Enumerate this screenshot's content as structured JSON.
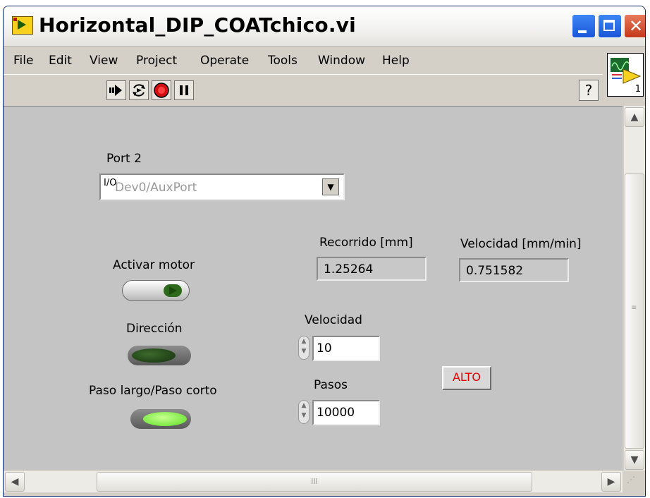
{
  "window": {
    "title": "Horizontal_DIP_COATchico.vi"
  },
  "menu": {
    "items": [
      "File",
      "Edit",
      "View",
      "Project",
      "Operate",
      "Tools",
      "Window",
      "Help"
    ]
  },
  "toolbar": {
    "tools": [
      "run-arrow-icon",
      "run-continuously-icon",
      "abort-icon",
      "pause-icon"
    ],
    "help_label": "?"
  },
  "panel_icon": {
    "number": "1"
  },
  "controls": {
    "port": {
      "label": "Port 2",
      "io_prefix": "I/O",
      "value": "Dev0/AuxPort"
    },
    "recorrido": {
      "label": "Recorrido [mm]",
      "value": "1.25264"
    },
    "velocidad_ind": {
      "label": "Velocidad [mm/min]",
      "value": "0.751582"
    },
    "activar_motor": {
      "label": "Activar motor"
    },
    "direccion": {
      "label": "Dirección"
    },
    "paso": {
      "label": "Paso largo/Paso corto"
    },
    "velocidad": {
      "label": "Velocidad",
      "value": "10"
    },
    "pasos": {
      "label": "Pasos",
      "value": "10000"
    },
    "alto": {
      "label": "ALTO"
    }
  },
  "scrollbar_thumb_label": "III",
  "colors": {
    "panel_bg": "#c4c4c4",
    "led_on": "#7dff3a",
    "led_off": "#1a3a12",
    "alto_text": "#e00000"
  }
}
